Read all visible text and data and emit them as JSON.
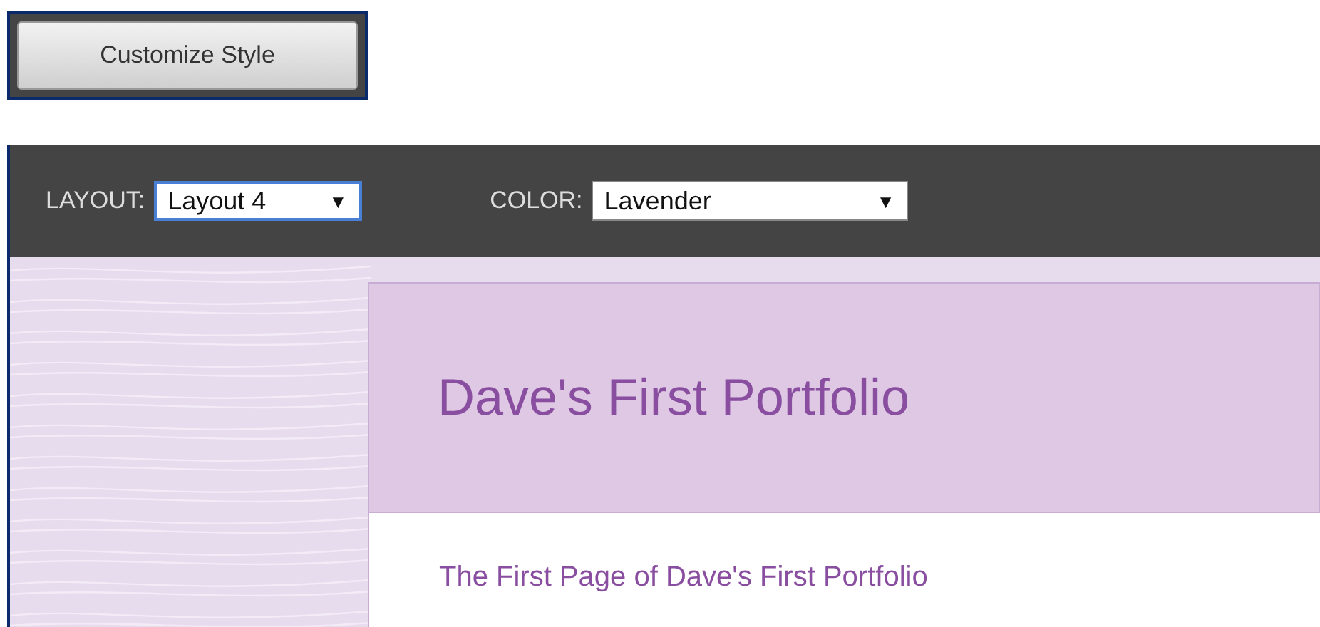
{
  "customize_button": {
    "label": "Customize Style"
  },
  "toolbar": {
    "controls": [
      {
        "label": "LAYOUT:",
        "value": "Layout 4",
        "arrow": "▼",
        "focused": true
      },
      {
        "label": "COLOR:",
        "value": "Lavender",
        "arrow": "▼",
        "focused": false
      }
    ]
  },
  "page": {
    "title": "Dave's First Portfolio",
    "subtitle": "The First Page of Dave's First Portfolio"
  }
}
